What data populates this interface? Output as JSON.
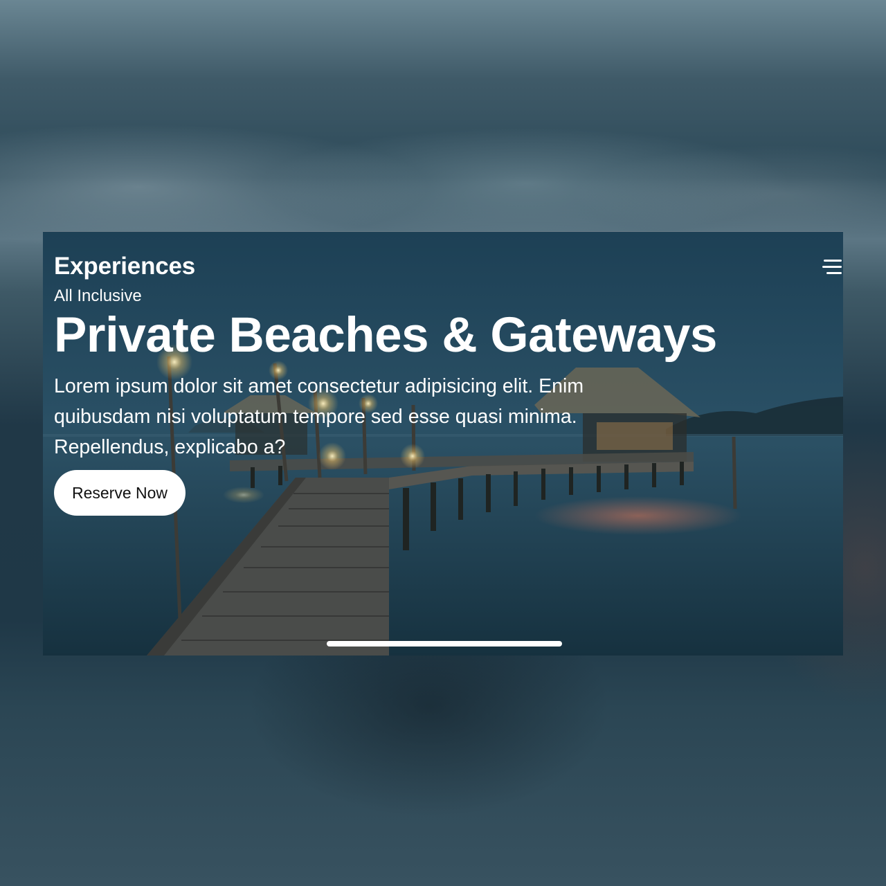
{
  "header": {
    "brand": "Experiences",
    "menu_icon": "hamburger-menu-icon"
  },
  "hero": {
    "kicker": "All Inclusive",
    "title": "Private Beaches & Gateways",
    "description": "Lorem ipsum dolor sit amet consectetur adipisicing elit. Enim quibusdam nisi voluptatum tempore sed esse quasi minima. Repellendus, explicabo a?",
    "cta_label": "Reserve Now",
    "background_image": "night pier over sea with thatched huts and string lights"
  },
  "colors": {
    "text": "#ffffff",
    "button_background": "#ffffff",
    "button_text": "#111111"
  }
}
